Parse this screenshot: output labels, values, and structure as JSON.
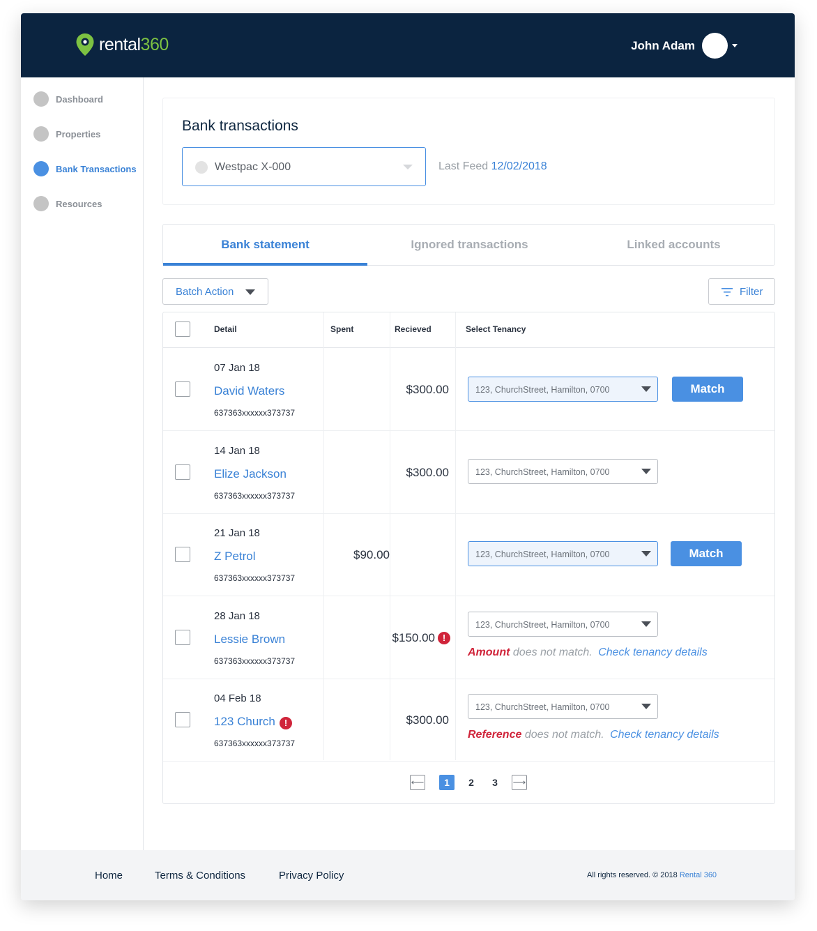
{
  "brand": {
    "name_part1": "rental",
    "name_part2": "360",
    "colors": {
      "navy": "#0b2440",
      "green": "#7dc242",
      "blue": "#4a90e2",
      "alert": "#d0243a"
    }
  },
  "user": {
    "name": "John Adam",
    "menu_icon": "caret-down-icon"
  },
  "sidebar": {
    "items": [
      {
        "label": "Dashboard",
        "active": false
      },
      {
        "label": "Properties",
        "active": false
      },
      {
        "label": "Bank Transactions",
        "active": true
      },
      {
        "label": "Resources",
        "active": false
      }
    ]
  },
  "header": {
    "title": "Bank transactions",
    "account_selected": "Westpac X-000",
    "last_feed_label": "Last Feed",
    "last_feed_date": "12/02/2018"
  },
  "tabs": [
    {
      "label": "Bank statement",
      "active": true
    },
    {
      "label": "Ignored transactions",
      "active": false
    },
    {
      "label": "Linked accounts",
      "active": false
    }
  ],
  "toolbar": {
    "batch_label": "Batch Action",
    "filter_label": "Filter"
  },
  "table": {
    "columns": {
      "detail": "Detail",
      "spent": "Spent",
      "received": "Recieved",
      "tenancy": "Select Tenancy"
    },
    "rows": [
      {
        "date": "07 Jan 18",
        "name": "David Waters",
        "ref": "637363xxxxxx373737",
        "spent": "",
        "received": "$300.00",
        "tenancy": "123, ChurchStreet, Hamilton, 0700",
        "match_label": "Match"
      },
      {
        "date": "14 Jan 18",
        "name": "Elize Jackson",
        "ref": "637363xxxxxx373737",
        "spent": "",
        "received": "$300.00",
        "tenancy": "123, ChurchStreet, Hamilton, 0700"
      },
      {
        "date": "21 Jan 18",
        "name": "Z Petrol",
        "ref": "637363xxxxxx373737",
        "spent": "$90.00",
        "received": "",
        "tenancy": "123, ChurchStreet, Hamilton, 0700",
        "match_label": "Match"
      },
      {
        "date": "28 Jan 18",
        "name": "Lessie Brown",
        "ref": "637363xxxxxx373737",
        "spent": "",
        "received": "$150.00",
        "tenancy": "123, ChurchStreet, Hamilton, 0700",
        "warn_key": "Amount",
        "warn_text": "does not match.",
        "warn_link": "Check tenancy details"
      },
      {
        "date": "04 Feb 18",
        "name": "123 Church",
        "ref": "637363xxxxxx373737",
        "spent": "",
        "received": "$300.00",
        "tenancy": "123, ChurchStreet, Hamilton, 0700",
        "warn_key": "Reference",
        "warn_text": "does not match.",
        "warn_link": "Check tenancy details"
      }
    ]
  },
  "pagination": {
    "pages": [
      "1",
      "2",
      "3"
    ],
    "current": "1",
    "prev_glyph": "⟵",
    "next_glyph": "⟶"
  },
  "footer": {
    "links": [
      "Home",
      "Terms & Conditions",
      "Privacy Policy"
    ],
    "copyright": "All rights reserved. © 2018",
    "copyright_brand": "Rental 360"
  }
}
